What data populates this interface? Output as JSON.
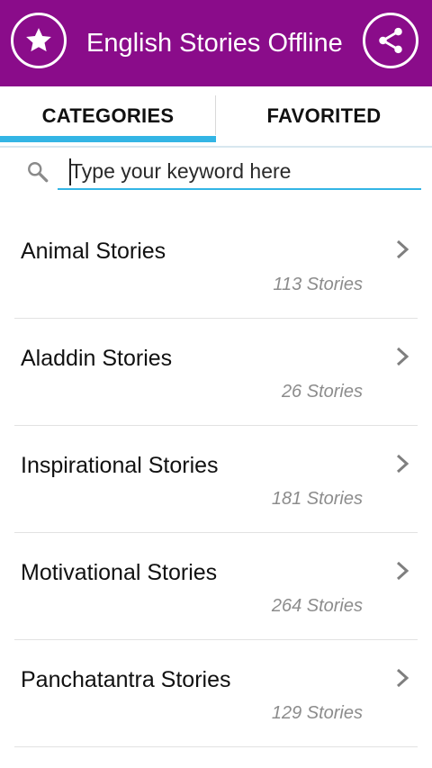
{
  "app": {
    "title": "English Stories Offline",
    "header_color": "#8a0c8a",
    "accent_color": "#33b5e5",
    "left_icon": "star-icon",
    "right_icon": "share-icon"
  },
  "tabs": [
    {
      "label": "CATEGORIES",
      "selected": true
    },
    {
      "label": "FAVORITED",
      "selected": false
    }
  ],
  "search": {
    "placeholder": "Type your keyword here",
    "value": "",
    "icon": "search-icon"
  },
  "categories": [
    {
      "title": "Animal Stories",
      "count": "113 Stories"
    },
    {
      "title": "Aladdin Stories",
      "count": "26 Stories"
    },
    {
      "title": "Inspirational Stories",
      "count": "181 Stories"
    },
    {
      "title": "Motivational Stories",
      "count": "264 Stories"
    },
    {
      "title": "Panchatantra Stories",
      "count": "129 Stories"
    }
  ]
}
